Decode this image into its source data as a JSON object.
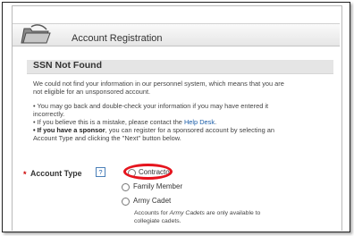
{
  "header": {
    "title": "Account Registration"
  },
  "section": {
    "title": "SSN Not Found"
  },
  "message": {
    "intro_line1": "We could not find your information in our personnel system, which means that you are",
    "intro_line2": "not eligible for an unsponsored account.",
    "bullet1_line1": "• You may go back and double-check your information if you may have entered it",
    "bullet1_line2": "incorrectly.",
    "bullet2_prefix": "• If you believe this is a mistake, please contact the ",
    "bullet2_link": "Help Desk",
    "bullet2_suffix": ".",
    "bullet3_bold": "• If you have a sponsor",
    "bullet3_rest": ", you can register for a sponsored account by selecting an",
    "bullet3_line2": "Account Type and clicking the \"Next\" button below."
  },
  "form": {
    "required_marker": "*",
    "account_type_label": "Account Type",
    "help_icon_text": "?",
    "options": [
      "Contractor",
      "Family Member",
      "Army Cadet"
    ],
    "cadet_note_prefix": "Accounts for ",
    "cadet_note_em": "Army Cadets",
    "cadet_note_suffix": " are only available to",
    "cadet_note_line2": "collegiate cadets."
  },
  "colors": {
    "highlight": "#e5141d",
    "link": "#1a5da8",
    "required": "#cc0000"
  }
}
